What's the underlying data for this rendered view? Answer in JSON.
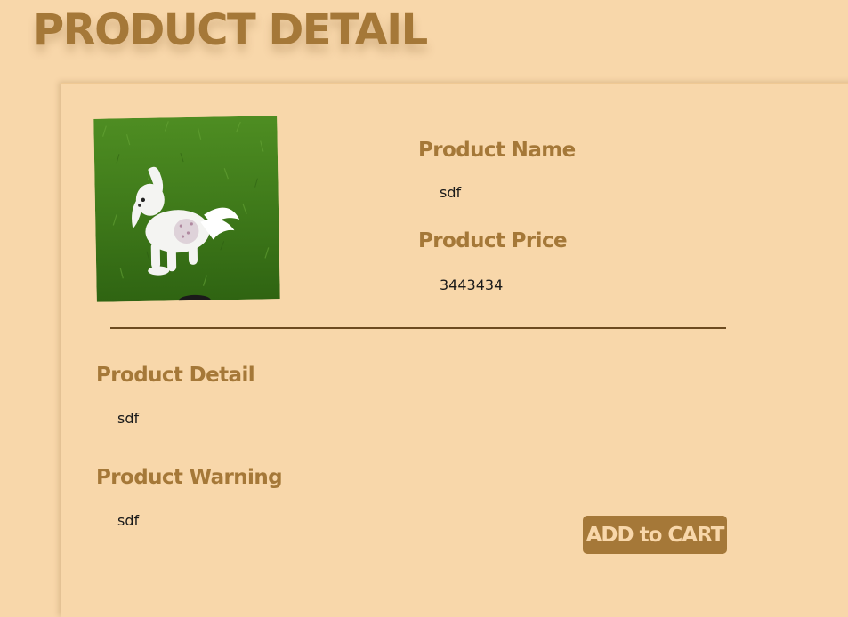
{
  "page": {
    "title": "PRODUCT DETAIL"
  },
  "product": {
    "image_alt": "product photo of a small white dog on grass",
    "name_label": "Product Name",
    "name_value": "sdf",
    "price_label": "Product Price",
    "price_value": "3443434",
    "detail_label": "Product Detail",
    "detail_value": "sdf",
    "warning_label": "Product Warning",
    "warning_value": "sdf"
  },
  "actions": {
    "add_to_cart_label": "ADD to CART"
  },
  "colors": {
    "background": "#f8d7aa",
    "accent": "#a57838",
    "divider": "#6d4b20",
    "text": "#1a1a1a"
  }
}
